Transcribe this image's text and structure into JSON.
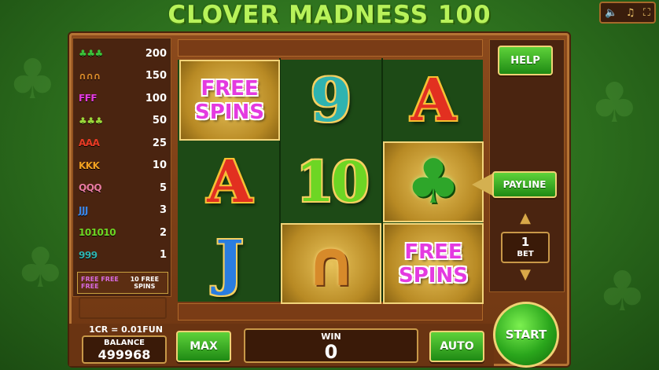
{
  "title": "CLOVER MADNESS 100",
  "topbar": {
    "sound_icon": "🔈",
    "music_icon": "♫",
    "fullscreen_icon": "⛶"
  },
  "paytable": [
    {
      "symbol": "♣♣♣",
      "color": "#3bc43a",
      "payout": "200"
    },
    {
      "symbol": "∩∩∩",
      "color": "#d98a2a",
      "payout": "150"
    },
    {
      "symbol": "FFF",
      "color": "#e43ae0",
      "payout": "100"
    },
    {
      "symbol": "♣♣♣",
      "color": "#9ad83a",
      "payout": "50"
    },
    {
      "symbol": "AAA",
      "color": "#e83a24",
      "payout": "25"
    },
    {
      "symbol": "KKK",
      "color": "#f0a020",
      "payout": "10"
    },
    {
      "symbol": "QQQ",
      "color": "#e87aa0",
      "payout": "5"
    },
    {
      "symbol": "JJJ",
      "color": "#3a86e8",
      "payout": "3"
    },
    {
      "symbol": "101010",
      "color": "#6dd624",
      "payout": "2"
    },
    {
      "symbol": "999",
      "color": "#2fb3b0",
      "payout": "1"
    }
  ],
  "free_spins_row": {
    "icons": "FREE FREE FREE",
    "text": "10 FREE SPINS"
  },
  "reels": [
    [
      "FREE SPINS",
      "A",
      "J"
    ],
    [
      "9",
      "10",
      "∩"
    ],
    [
      "A",
      "♣",
      "FREE SPINS"
    ]
  ],
  "buttons": {
    "help": "HELP",
    "payline": "PAYLINE",
    "max": "MAX",
    "auto": "AUTO",
    "start": "START"
  },
  "bet": {
    "value": "1",
    "label": "BET"
  },
  "rate": "1CR = 0.01FUN",
  "balance": {
    "label": "BALANCE",
    "value": "499968"
  },
  "win": {
    "label": "WIN",
    "value": "0"
  },
  "colors": {
    "title": "#b8f25a",
    "frame": "#8c4a1c",
    "button_green": "#2aa61c",
    "gold": "#f0d274"
  }
}
